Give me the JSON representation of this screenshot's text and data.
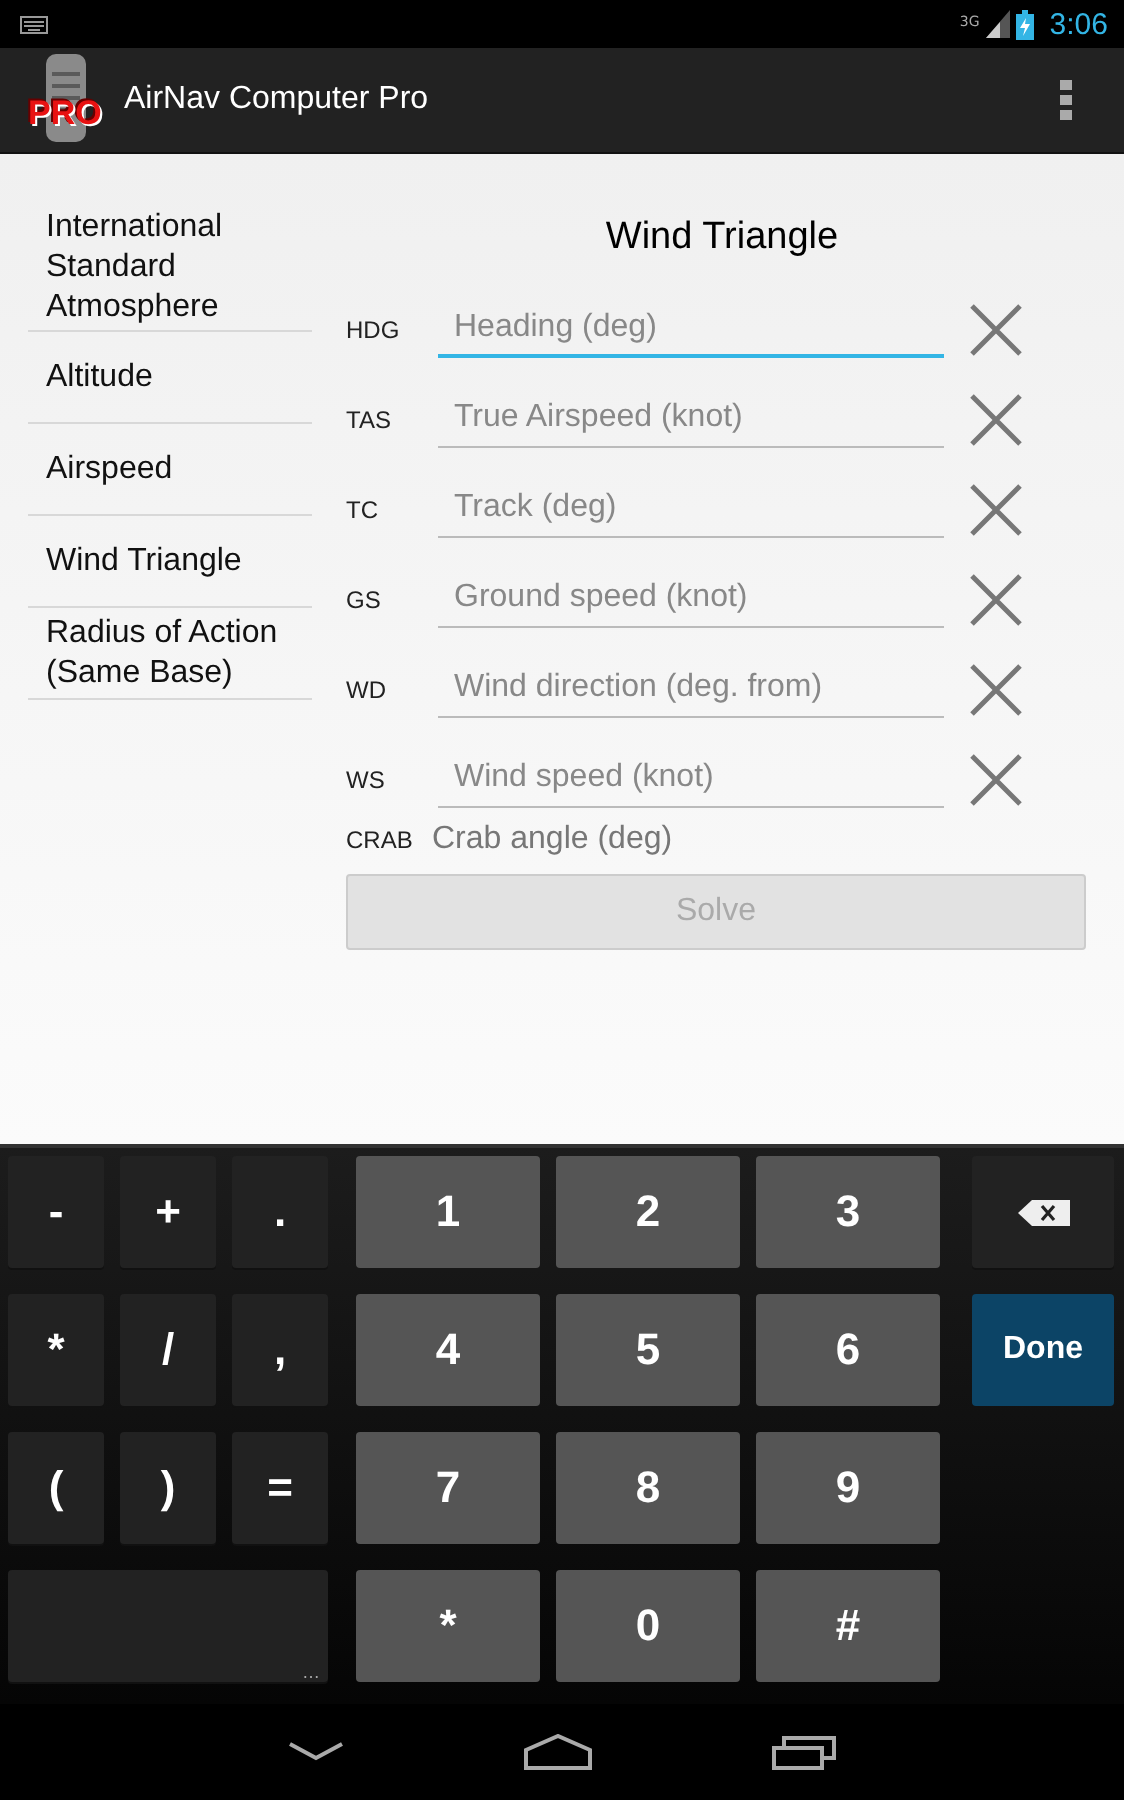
{
  "status_bar": {
    "network": "3G",
    "time": "3:06"
  },
  "action_bar": {
    "logo_badge": "PRO",
    "title": "AirNav Computer Pro"
  },
  "sidebar": {
    "items": [
      {
        "label": "International Standard Atmosphere"
      },
      {
        "label": "Altitude"
      },
      {
        "label": "Airspeed"
      },
      {
        "label": "Wind Triangle"
      },
      {
        "label": "Radius of Action (Same Base)"
      }
    ]
  },
  "form": {
    "title": "Wind Triangle",
    "fields": [
      {
        "label": "HDG",
        "placeholder": "Heading (deg)",
        "focused": true
      },
      {
        "label": "TAS",
        "placeholder": "True Airspeed (knot)",
        "focused": false
      },
      {
        "label": "TC",
        "placeholder": "Track (deg)",
        "focused": false
      },
      {
        "label": "GS",
        "placeholder": "Ground speed (knot)",
        "focused": false
      },
      {
        "label": "WD",
        "placeholder": "Wind direction (deg. from)",
        "focused": false
      },
      {
        "label": "WS",
        "placeholder": "Wind speed (knot)",
        "focused": false
      }
    ],
    "result": {
      "label": "CRAB",
      "text": "Crab angle (deg)"
    },
    "solve_button": {
      "label": "Solve",
      "disabled": true
    }
  },
  "keyboard": {
    "rows": [
      [
        {
          "kind": "symbol",
          "label": "-"
        },
        {
          "kind": "symbol",
          "label": "+"
        },
        {
          "kind": "symbol",
          "label": "."
        },
        {
          "kind": "digit",
          "label": "1"
        },
        {
          "kind": "digit",
          "label": "2"
        },
        {
          "kind": "digit",
          "label": "3"
        },
        {
          "kind": "backspace"
        }
      ],
      [
        {
          "kind": "symbol",
          "label": "*"
        },
        {
          "kind": "symbol",
          "label": "/"
        },
        {
          "kind": "symbol",
          "label": ","
        },
        {
          "kind": "digit",
          "label": "4"
        },
        {
          "kind": "digit",
          "label": "5"
        },
        {
          "kind": "digit",
          "label": "6"
        },
        {
          "kind": "done",
          "label": "Done"
        }
      ],
      [
        {
          "kind": "symbol",
          "label": "("
        },
        {
          "kind": "symbol",
          "label": ")"
        },
        {
          "kind": "symbol",
          "label": "="
        },
        {
          "kind": "digit",
          "label": "7"
        },
        {
          "kind": "digit",
          "label": "8"
        },
        {
          "kind": "digit",
          "label": "9"
        }
      ],
      [
        {
          "kind": "space",
          "label": "…"
        },
        "",
        "",
        {
          "kind": "digit",
          "label": "*"
        },
        {
          "kind": "digit",
          "label": "0"
        },
        {
          "kind": "digit",
          "label": "#"
        }
      ]
    ]
  }
}
